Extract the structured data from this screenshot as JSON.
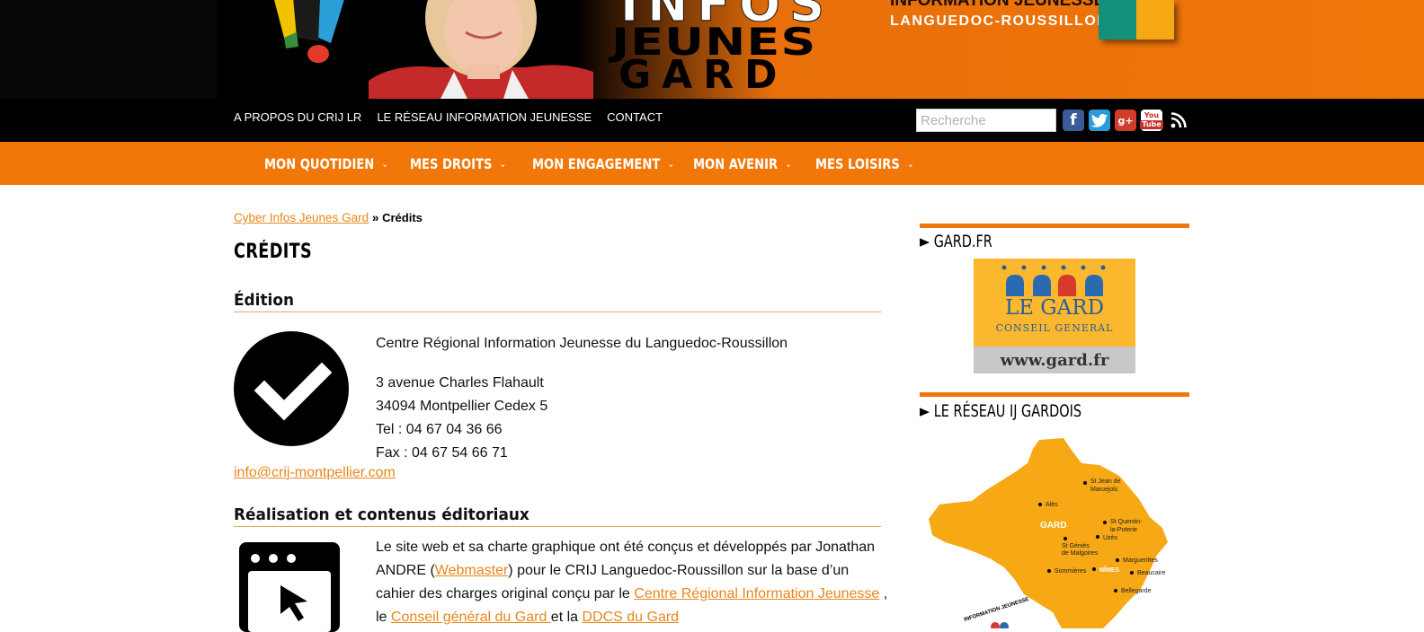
{
  "banner": {
    "logo_infos": "INFOS",
    "logo_jeunes": "JEUNES",
    "logo_gard": "GARD",
    "network_line1": "INFORMATION JEUNESSE",
    "network_line2": "LANGUEDOC-ROUSSILLON",
    "colors": {
      "orange": "#f07708",
      "teal": "#14917c",
      "yellow": "#f6a815"
    }
  },
  "topbar": {
    "links": [
      "A PROPOS DU CRIJ LR",
      "LE RÉSEAU INFORMATION JEUNESSE",
      "CONTACT"
    ],
    "search_placeholder": "Recherche",
    "social_icons": [
      "facebook-icon",
      "twitter-icon",
      "google-plus-icon",
      "youtube-icon",
      "rss-icon"
    ],
    "facebook_glyph": "f",
    "gplus_glyph": "g+",
    "youtube_glyph_1": "You",
    "youtube_glyph_2": "Tube"
  },
  "nav": {
    "items": [
      {
        "label": "MON QUOTIDIEN"
      },
      {
        "label": "MES DROITS"
      },
      {
        "label": "MON ENGAGEMENT"
      },
      {
        "label": "MON AVENIR"
      },
      {
        "label": "MES LOISIRS"
      }
    ],
    "chevron": "⌄"
  },
  "breadcrumb": {
    "home": "Cyber Infos Jeunes Gard",
    "separator": " » ",
    "current": "Crédits"
  },
  "page": {
    "title": "CRÉDITS",
    "edition": {
      "heading": "Édition",
      "organization": "Centre Régional Information Jeunesse du Languedoc-Roussillon",
      "address1": "3 avenue Charles Flahault",
      "address2": "34094 Montpellier Cedex 5",
      "tel": "Tel : 04 67 04 36 66",
      "fax": "Fax : 04 67 54 66 71",
      "email": "info@crij-montpellier.com"
    },
    "realisation": {
      "heading": "Réalisation et contenus éditoriaux",
      "text1": "Le site web et sa charte graphique ont été conçus et développés par Jonathan ANDRE (",
      "webmaster_link": "Webmaster",
      "text2": ") pour le CRIJ Languedoc-Roussillon sur la base d’un cahier des charges original conçu par le ",
      "crij_link": "Centre Régional Information Jeunesse",
      "text3": " , le ",
      "cg_link": "Conseil général du Gard ",
      "text4": "et la ",
      "ddcs_link": "DDCS du Gard"
    }
  },
  "sidebar": {
    "gard_widget_title": "► GARD.FR",
    "gard_logo_name": "LE GARD",
    "gard_logo_sub": "CONSEIL GENERAL",
    "gard_logo_url": "www.gard.fr",
    "reseau_widget_title": "► LE RÉSEAU IJ GARDOIS",
    "map_labels": {
      "st_jean": "St Jean de",
      "st_jean2": "Maruejols",
      "ales": "Alès",
      "gard": "GARD",
      "st_quentin": "St Quentin-",
      "st_quentin2": "la-Poterie",
      "uzes": "Uzès",
      "st_genies": "St Géniès",
      "st_genies2": "de Malgoires",
      "marguerittes": "Marguerittes",
      "sommieres": "Sommières",
      "nimes": "NÎMES",
      "beaucaire": "Beaucaire",
      "bellegarde": "Bellegarde",
      "info_jeunesse": "INFORMATION JEUNESSE"
    }
  }
}
